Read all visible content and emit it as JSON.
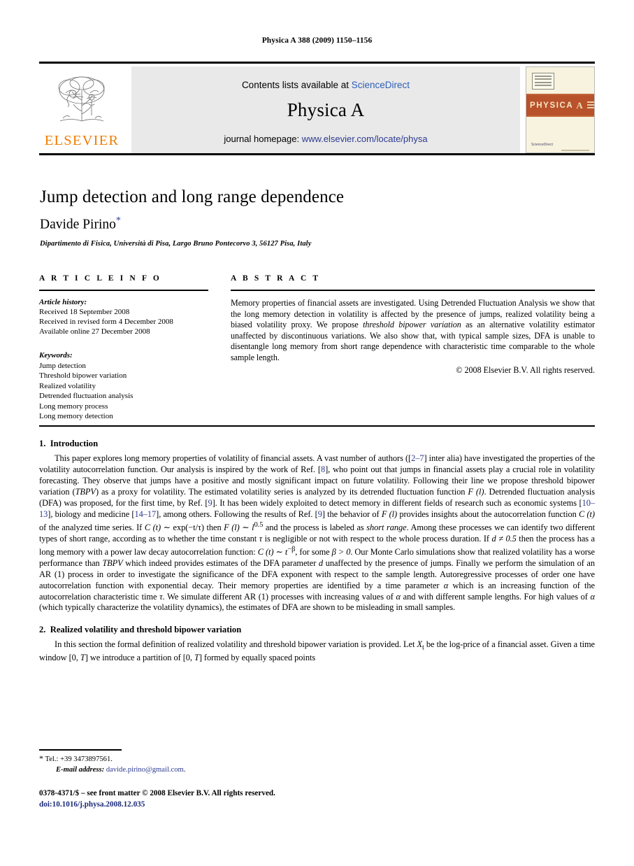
{
  "running_head": "Physica A 388 (2009) 1150–1156",
  "masthead": {
    "publisher_name": "ELSEVIER",
    "contents_prefix": "Contents lists available at ",
    "contents_link": "ScienceDirect",
    "journal_title": "Physica A",
    "homepage_prefix": "journal homepage: ",
    "homepage_link": "www.elsevier.com/locate/physa",
    "cover": {
      "title": "PHYSICA",
      "title_letter": "A",
      "sciencedirect": "ScienceDirect"
    }
  },
  "article": {
    "title": "Jump detection and long range dependence",
    "author": "Davide Pirino",
    "author_marker": "*",
    "affiliation": "Dipartimento di Fisica, Università di Pisa, Largo Bruno Pontecorvo 3, 56127 Pisa, Italy"
  },
  "info": {
    "heading": "A R T I C L E    I N F O",
    "history_label": "Article history:",
    "history": [
      "Received 18 September 2008",
      "Received in revised form 4 December 2008",
      "Available online 27 December 2008"
    ],
    "keywords_label": "Keywords:",
    "keywords": [
      "Jump detection",
      "Threshold bipower variation",
      "Realized volatility",
      "Detrended fluctuation analysis",
      "Long memory process",
      "Long memory detection"
    ]
  },
  "abstract": {
    "heading": "A B S T R A C T",
    "text_1": "Memory properties of financial assets are investigated. Using Detrended Fluctuation Analysis we show that the long memory detection in volatility is affected by the presence of jumps, realized volatility being a biased volatility proxy. We propose ",
    "emph_1": "threshold bipower variation",
    "text_2": " as an alternative volatility estimator unaffected by discontinuous variations. We also show that, with typical sample sizes, DFA is unable to disentangle long memory from short range dependence with characteristic time comparable to the whole sample length.",
    "copyright": "© 2008 Elsevier B.V. All rights reserved."
  },
  "sections": {
    "intro": {
      "number": "1.",
      "heading": "Introduction",
      "p1_a": "This paper explores long memory properties of volatility of financial assets. A vast number of authors ([",
      "ref_2_7": "2–7",
      "p1_b": "] inter alia) have investigated the properties of the volatility autocorrelation function. Our analysis is inspired by the work of Ref. [",
      "ref_8": "8",
      "p1_c": "], who point out that jumps in financial assets play a crucial role in volatility forecasting. They observe that jumps have a positive and mostly significant impact on future volatility. Following their line we propose threshold bipower variation (",
      "emph_tbpv_1": "TBPV",
      "p1_d": ") as a proxy for volatility. The estimated volatility series is analyzed by its detrended fluctuation function ",
      "math_F_l_1": "F (l)",
      "p1_e": ". Detrended fluctuation analysis (DFA) was proposed, for the first time, by Ref. [",
      "ref_9_a": "9",
      "p1_f": "]. It has been widely exploited to detect memory in different fields of research such as economic systems [",
      "ref_10_13": "10–13",
      "p1_g": "], biology and medicine [",
      "ref_14_17": "14–17",
      "p1_h": "], among others. Following the results of Ref. [",
      "ref_9_b": "9",
      "p1_i": "] the behavior of ",
      "math_F_l_2": "F (l)",
      "p1_j": " provides insights about the autocorrelation function ",
      "math_C_t_1": "C (t)",
      "p1_k": " of the analyzed time series. If ",
      "math_C_t_2": "C (t)",
      "p1_l": " ∼ exp(−t/τ) then ",
      "math_F_l_3": "F (l)",
      "p1_m": " ∼ ",
      "math_l_05": "l",
      "math_l_05_sup": "0.5",
      "p1_n": " and the process is labeled as ",
      "emph_short_range": "short range",
      "p1_o": ". Among these processes we can identify two different types of short range, according as to whether the time constant ",
      "math_tau": "τ",
      "p1_p": " is negligible or not with respect to the whole process duration. If ",
      "math_d_neq": "d ≠ 0.5",
      "p1_q": " then the process has a long memory with a power law decay autocorrelation function: ",
      "math_C_t_3": "C (t)",
      "p1_r": " ∼ ",
      "math_t_beta": "t",
      "math_t_beta_sup": "−β",
      "p1_s": ", for some ",
      "math_beta_gt": "β > 0",
      "p1_t": ". Our Monte Carlo simulations show that realized volatility has a worse performance than ",
      "emph_tbpv_2": "TBPV",
      "p1_u": " which indeed provides estimates of the DFA parameter ",
      "math_d": "d",
      "p1_v": " unaffected by the presence of jumps. Finally we perform the simulation of an AR (1) process in order to investigate the significance of the DFA exponent with respect to the sample length. Autoregressive processes of order one have autocorrelation function with exponential decay. Their memory properties are identified by a time parameter ",
      "math_alpha_1": "α",
      "p1_w": " which is an increasing function of the autocorrelation characteristic time ",
      "math_tau_2": "τ",
      "p1_x": ". We simulate different AR (1) processes with increasing values of ",
      "math_alpha_2": "α",
      "p1_y": " and with different sample lengths. For high values of ",
      "math_alpha_3": "α",
      "p1_z": " (which typically characterize the volatility dynamics), the estimates of DFA are shown to be misleading in small samples."
    },
    "realized": {
      "number": "2.",
      "heading": "Realized volatility and threshold bipower variation",
      "p1_a": "In this section the formal definition of realized volatility and threshold bipower variation is provided. Let ",
      "math_X": "X",
      "math_X_sub": "t",
      "p1_b": " be the log-price of a financial asset. Given a time window [0, ",
      "math_T_1": "T",
      "p1_c": "] we introduce a partition of [0, ",
      "math_T_2": "T",
      "p1_d": "] formed by equally spaced points"
    }
  },
  "footnotes": {
    "marker": "*",
    "tel": "Tel.: +39 3473897561.",
    "email_label": "E-mail address:",
    "email": "davide.pirino@gmail.com",
    "email_period": "."
  },
  "imprint": {
    "line1": "0378-4371/$ – see front matter © 2008 Elsevier B.V. All rights reserved.",
    "doi": "doi:10.1016/j.physa.2008.12.035"
  }
}
